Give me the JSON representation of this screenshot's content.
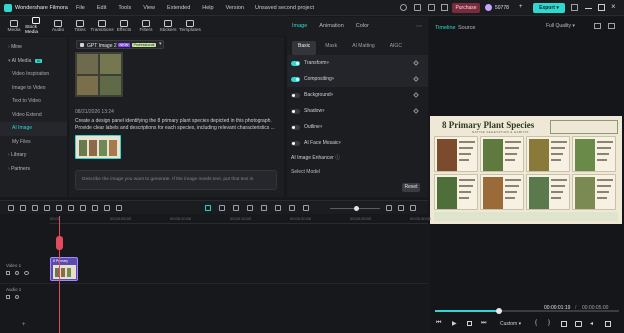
{
  "app": {
    "name": "Wondershare Filmora",
    "project_title": "Unsaved second project",
    "menu": [
      "File",
      "Edit",
      "Tools",
      "View",
      "Extended",
      "Help",
      "Version"
    ],
    "purchase_label": "Purchase",
    "credits": "50778",
    "export_label": "Export",
    "brand_color": "#30d8d0"
  },
  "toolbar": {
    "items": [
      {
        "label": "Media",
        "icon": "media-icon"
      },
      {
        "label": "Stock Media",
        "icon": "stock-media-icon"
      },
      {
        "label": "Audio",
        "icon": "audio-icon"
      },
      {
        "label": "Titles",
        "icon": "titles-icon"
      },
      {
        "label": "Transitions",
        "icon": "transitions-icon"
      },
      {
        "label": "Effects",
        "icon": "effects-icon"
      },
      {
        "label": "Filters",
        "icon": "filters-icon"
      },
      {
        "label": "Stickers",
        "icon": "stickers-icon"
      },
      {
        "label": "Templates",
        "icon": "templates-icon"
      }
    ]
  },
  "sidebar": {
    "items": [
      {
        "label": "Mine",
        "type": "head"
      },
      {
        "label": "AI Media",
        "type": "head"
      },
      {
        "label": "Video Inspiration",
        "type": "item"
      },
      {
        "label": "Image to Video",
        "type": "item"
      },
      {
        "label": "Text to Video",
        "type": "item"
      },
      {
        "label": "Video Extend",
        "type": "item"
      },
      {
        "label": "AI Image",
        "type": "active"
      },
      {
        "label": "My Files",
        "type": "item"
      },
      {
        "label": "Library",
        "type": "head"
      },
      {
        "label": "Partners",
        "type": "head"
      }
    ],
    "ai_badge": "AI"
  },
  "ai_image": {
    "model_label": "GPT Image 2",
    "model_badge": "NEW",
    "model_pro": "Professional",
    "date": "08/21/2026 13:24",
    "prompt_text": "Create a design panel identifying the 8 primary plant species depicted in this photograph. Provide clear labels and descriptions for each species, including relevant characteristics ...",
    "input_placeholder": "Describe the image you want to generate. If the image needs text, put that text in"
  },
  "props": {
    "tabs": [
      "Image",
      "Animation",
      "Color"
    ],
    "subtabs": [
      "Basic",
      "Mask",
      "AI Matting",
      "AIGC"
    ],
    "rows": [
      {
        "label": "Transform",
        "on": true
      },
      {
        "label": "Compositing",
        "on": true
      },
      {
        "label": "Background",
        "on": false
      },
      {
        "label": "Shadow",
        "on": false
      },
      {
        "label": "Outline",
        "on": false
      },
      {
        "label": "AI Face Mosaic",
        "on": false
      }
    ],
    "enhancer_label": "AI Image Enhancer",
    "select_model": "Select Model",
    "reset_label": "Reset"
  },
  "preview": {
    "tabs": [
      "Timeline",
      "Source"
    ],
    "quality": "Full Quality",
    "poster_title": "8 Primary Plant Species",
    "poster_subtitle": "NATIVE VEGETATION & HABITAT",
    "time_current": "00:00:01:19",
    "time_total": "00:00:05:00",
    "zoom_label": "Custom",
    "progress": 0.35
  },
  "timeline": {
    "ruler": [
      "00:00",
      "00:00:05:00",
      "00:00:10:00",
      "00:00:15:00",
      "00:00:20:00",
      "00:00:25:00",
      "00:00:30:00"
    ],
    "video_track": "Video 1",
    "audio_track": "Audio 1",
    "clip_label": "8 Primary"
  }
}
